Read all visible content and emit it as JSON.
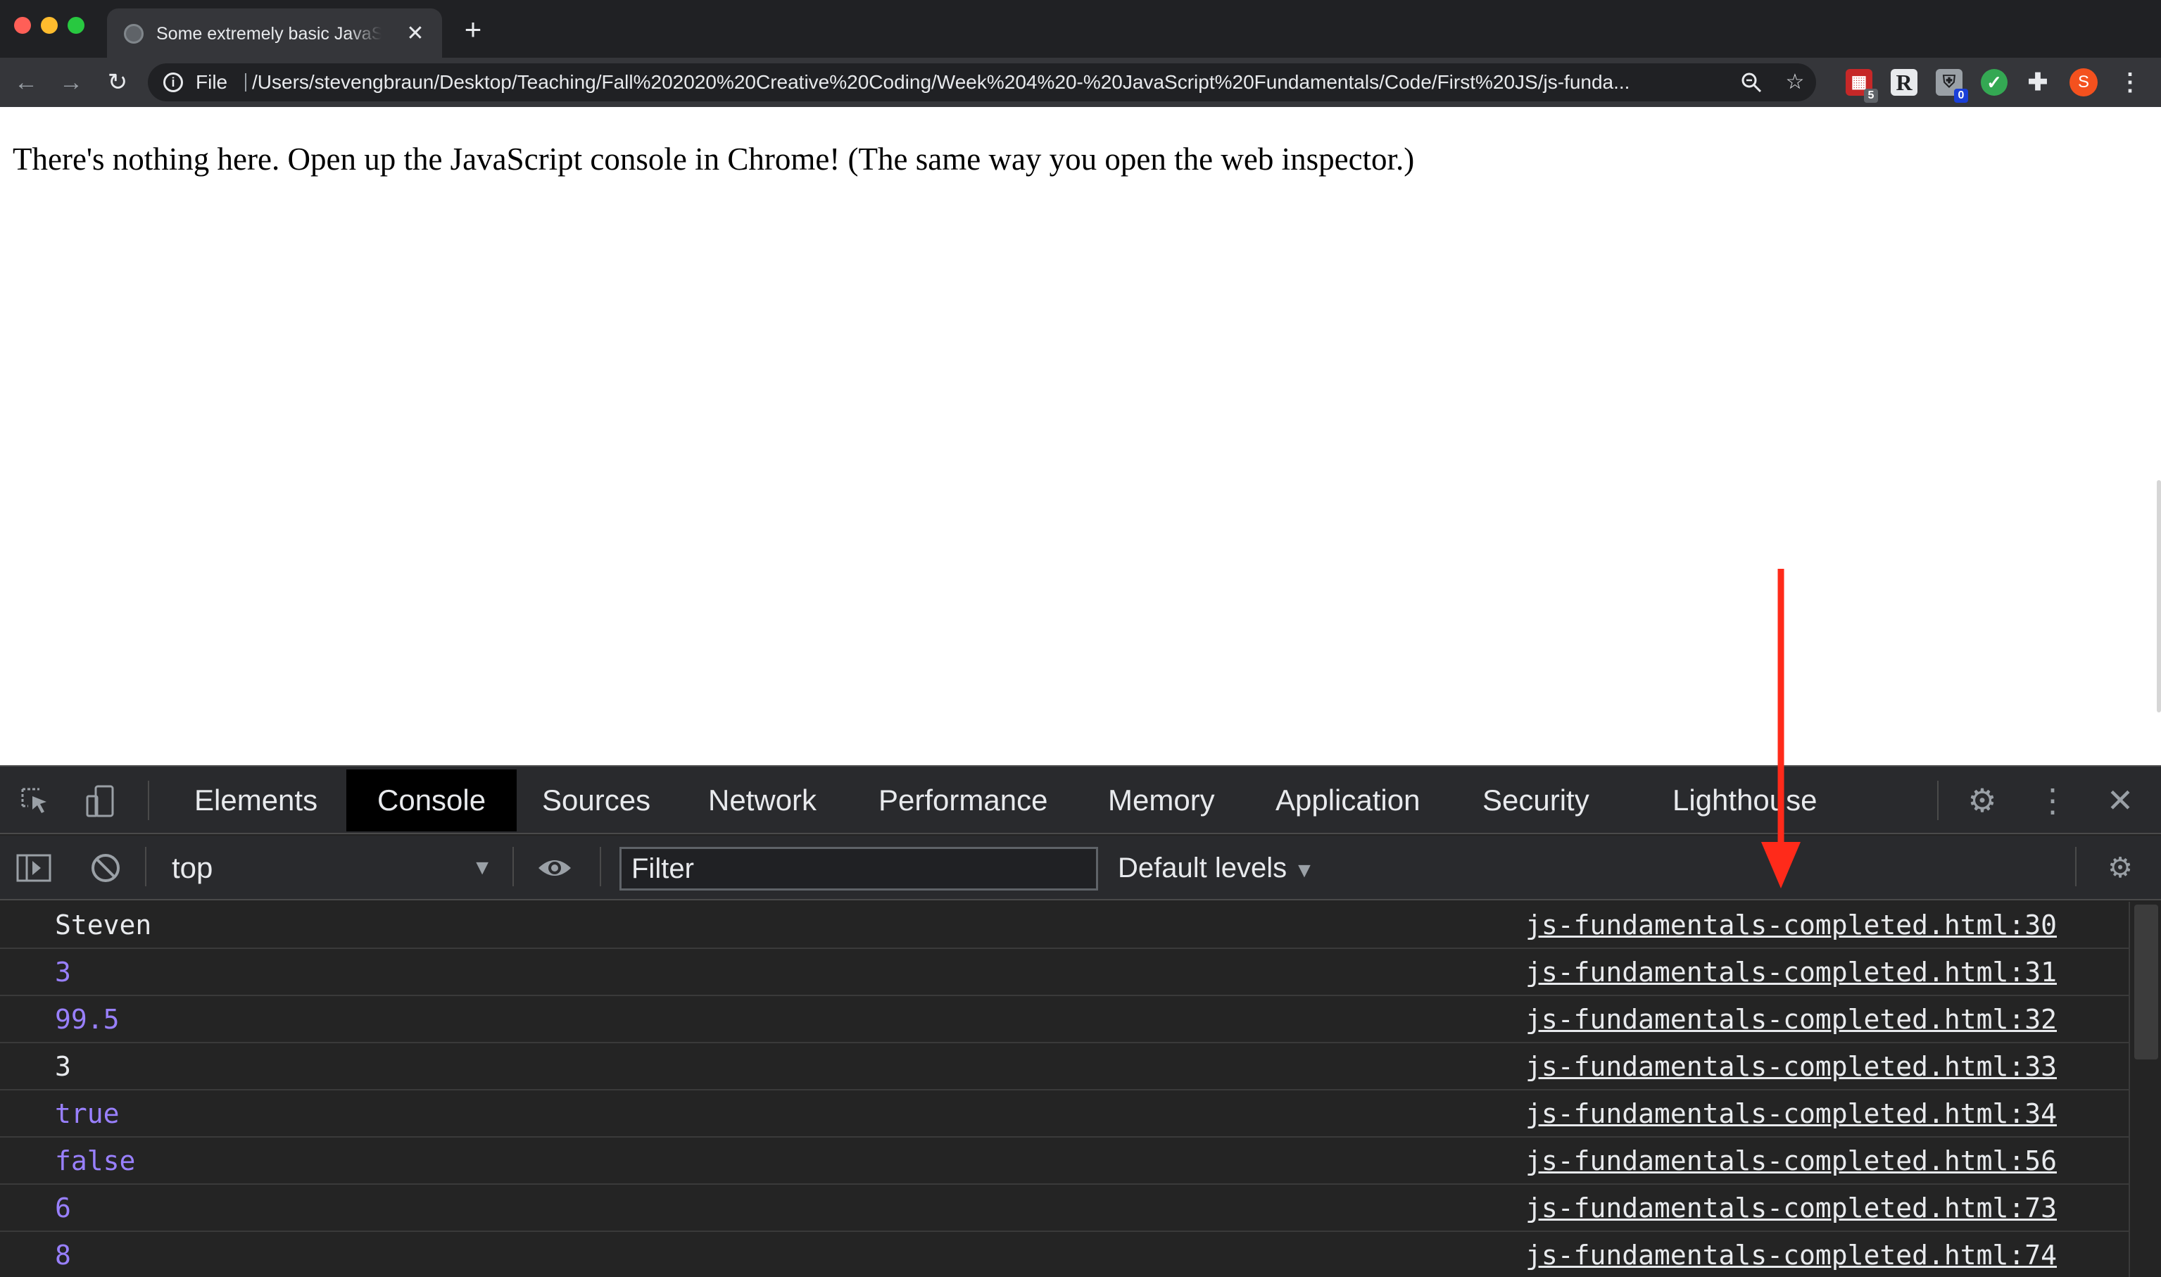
{
  "browser": {
    "tab": {
      "title": "Some extremely basic JavaScript",
      "close_icon": "close-icon"
    },
    "new_tab_icon": "plus-icon",
    "toolbar": {
      "back_icon": "arrow-left-icon",
      "forward_icon": "arrow-right-icon",
      "reload_icon": "reload-icon",
      "scheme_label": "File",
      "url": "/Users/stevengbraun/Desktop/Teaching/Fall%202020%20Creative%20Coding/Week%204%20-%20JavaScript%20Fundamentals/Code/First%20JS/js-funda...",
      "extensions": [
        {
          "name": "calendar-extension-icon",
          "badge": "5"
        },
        {
          "name": "r-extension-icon",
          "label": "R"
        },
        {
          "name": "shield-extension-icon",
          "badge": "0"
        },
        {
          "name": "check-extension-icon"
        },
        {
          "name": "puzzle-extensions-icon"
        }
      ],
      "avatar_initial": "S"
    }
  },
  "page": {
    "text": "There's nothing here. Open up the JavaScript console in Chrome! (The same way you open the web inspector.)"
  },
  "devtools": {
    "tabs": [
      "Elements",
      "Console",
      "Sources",
      "Network",
      "Performance",
      "Memory",
      "Application",
      "Security",
      "Lighthouse"
    ],
    "active_tab": "Console",
    "console_bar": {
      "context": "top",
      "filter_placeholder": "Filter",
      "levels": "Default levels"
    },
    "messages": [
      {
        "value": "Steven",
        "type": "string",
        "source": "js-fundamentals-completed.html:30"
      },
      {
        "value": "3",
        "type": "number",
        "source": "js-fundamentals-completed.html:31"
      },
      {
        "value": "99.5",
        "type": "number",
        "source": "js-fundamentals-completed.html:32"
      },
      {
        "value": "3",
        "type": "string",
        "source": "js-fundamentals-completed.html:33"
      },
      {
        "value": "true",
        "type": "bool",
        "source": "js-fundamentals-completed.html:34"
      },
      {
        "value": "false",
        "type": "bool",
        "source": "js-fundamentals-completed.html:56"
      },
      {
        "value": "6",
        "type": "number",
        "source": "js-fundamentals-completed.html:73"
      },
      {
        "value": "8",
        "type": "number",
        "source": "js-fundamentals-completed.html:74"
      }
    ]
  },
  "colors": {
    "annotation_arrow": "#ff2a1a",
    "console_number": "#9980ff",
    "active_tab_bg": "#000000"
  }
}
